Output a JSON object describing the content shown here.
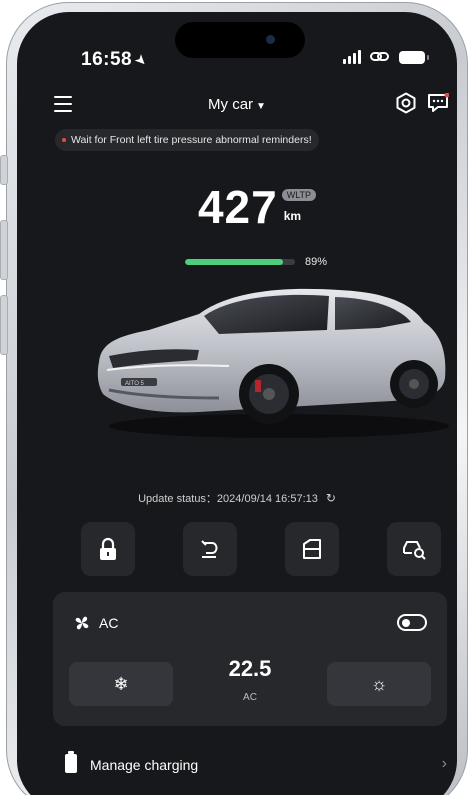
{
  "status": {
    "time": "16:58"
  },
  "nav": {
    "title": "My car"
  },
  "alert": {
    "text": "Wait for Front left tire pressure abnormal reminders!"
  },
  "range": {
    "value": "427",
    "standard": "WLTP",
    "unit": "km"
  },
  "battery": {
    "percent_label": "89%",
    "level_fraction": 0.89,
    "bar_color": "#4cd07d"
  },
  "car": {
    "badge": "AITO 5"
  },
  "update": {
    "text": "Update status：2024/09/14 16:57:13"
  },
  "controls": [
    {
      "name": "lock-icon"
    },
    {
      "name": "trunk-icon"
    },
    {
      "name": "window-icon"
    },
    {
      "name": "car-search-icon"
    }
  ],
  "ac": {
    "label": "AC",
    "temperature": "22.5",
    "mode": "AC",
    "toggle": "off"
  },
  "charging": {
    "label": "Manage charging",
    "chevron": "›"
  },
  "colors": {
    "background": "#17181b",
    "card": "#26282c",
    "accent": "#4cd07d",
    "alert_dot": "#e34b4b"
  }
}
